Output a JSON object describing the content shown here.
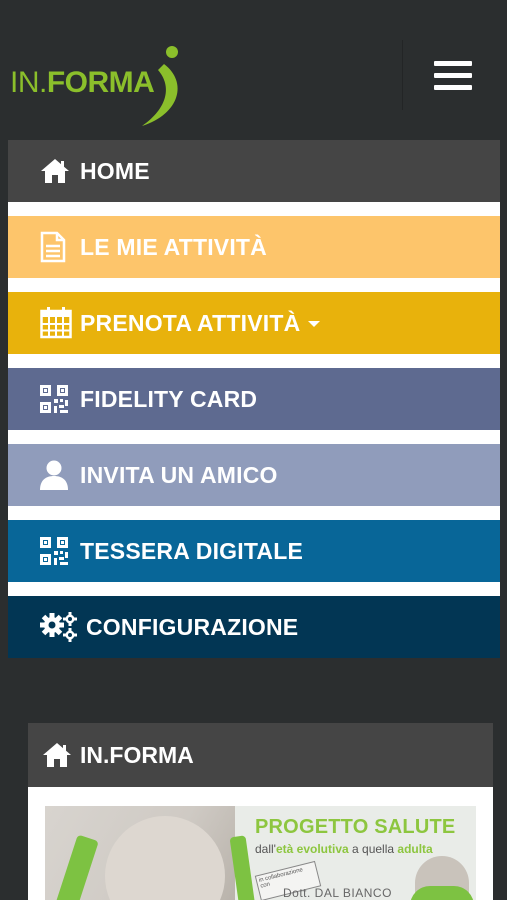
{
  "header": {
    "logo_in": "IN.",
    "logo_forma": "FORMA",
    "menu_icon": "hamburger-icon"
  },
  "menu": {
    "items": [
      {
        "label": "HOME",
        "icon": "home-icon",
        "color": "#454545"
      },
      {
        "label": "LE MIE ATTIVITÀ",
        "icon": "document-icon",
        "color": "#fdc56b"
      },
      {
        "label": "PRENOTA ATTIVITÀ",
        "icon": "calendar-icon",
        "color": "#e8b20c",
        "dropdown": true
      },
      {
        "label": "FIDELITY CARD",
        "icon": "qrcode-icon",
        "color": "#5e6a90"
      },
      {
        "label": "INVITA UN AMICO",
        "icon": "user-icon",
        "color": "#909cbb"
      },
      {
        "label": "TESSERA DIGITALE",
        "icon": "qrcode-icon",
        "color": "#086698"
      },
      {
        "label": "CONFIGURAZIONE",
        "icon": "gears-icon",
        "color": "#023654"
      }
    ]
  },
  "card": {
    "title": "IN.FORMA",
    "icon": "home-icon",
    "banner": {
      "title": "PROGETTO SALUTE",
      "subtitle_1": "dall'",
      "subtitle_2": "età evolutiva",
      "subtitle_3": " a quella ",
      "subtitle_4": "adulta",
      "tag": "in collaborazione con",
      "doctor": "Dott. DAL BIANCO"
    }
  }
}
